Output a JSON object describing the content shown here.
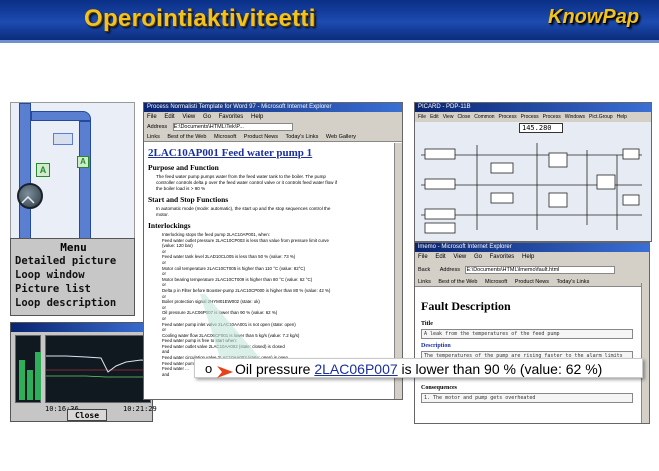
{
  "header": {
    "title": "Operointiaktiviteetti",
    "logo": "KnowPap"
  },
  "process": {
    "valve_label": "A",
    "valve_label_2": "A"
  },
  "menu": {
    "title": "Menu",
    "items": [
      "Detailed picture",
      "Loop window",
      "Picture list",
      "Loop description"
    ]
  },
  "trend": {
    "time_start": "10:16:36",
    "time_end": "10:21:29",
    "close_label": "Close"
  },
  "doc_window": {
    "titlebar": "Process Normalisti Template for Word 97 - Microsoft Internet Explorer",
    "menu": [
      "File",
      "Edit",
      "View",
      "Go",
      "Favorites",
      "Help"
    ],
    "address_label": "Address",
    "address_value": "E:\\Documents\\HTML\\Tek\\P...",
    "links": [
      "Links",
      "Best of the Web",
      "Microsoft",
      "Product News",
      "Today's Links",
      "Web Gallery"
    ],
    "heading": "2LAC10AP001 Feed water pump 1",
    "sections": [
      {
        "title": "Purpose and Function",
        "lines": [
          "The feed water pump pumps water from the feed water tank to the boiler. The pump",
          "controller controls delta p over the feed water control valve or it controls feed water flow if",
          "the boiler load is > 90 %"
        ]
      },
      {
        "title": "Start and Stop Functions",
        "lines": [
          "In automatic mode (mode: automatic), the start up and the stop sequences control the",
          "motor."
        ]
      },
      {
        "title": "Interlockings",
        "lines": [
          "Interlocking stops the feed pump 2LAC10AP001, when:",
          "Feed water outlet pressure 2LAC10CP003 is less than value from pressure limit curve",
          "(value: 120 bar)",
          "or",
          "Feed water tank level 2LAD10CL005 is less than 50 % (value: 73 %)",
          "or",
          "Motor coil temperature 2LAC10CT005 is higher than 110 °C (value: 82°C)",
          "or",
          "Motor bearing temperature 2LAC10CT009 is higher than 80 °C (value: 62 °C)",
          "or",
          "Delta p in Filter before Booster-pump 2LAC10CP000 is higher than 80 % (value: 42 %)",
          "or",
          "Boiler protection signal 2HYM01EW002 (state: ok)",
          "or",
          "Oil pressure 2LAC06P007 is lower than 90 % (value: 62 %)",
          "or",
          "Feed water pump inlet valve 2LAC10AA001 is not open (state: open)",
          "or",
          "Cooling water flow 2LAC06CF001 is lower than 5 kg/s (value: 7.2 kg/s)",
          "Feed water pump is free to start when:",
          "Feed water outlet valve 2LAC10AA002 (state: closed) is closed",
          "and",
          "Feed water circulation valve 2LAC10AA003 (state: open) is open",
          "Feed water pump is free to stop when:",
          "Feed water ...",
          "and"
        ]
      }
    ]
  },
  "schematic_window": {
    "titlebar": "PICARD - PDP-11B",
    "menu": [
      "File",
      "Edit",
      "View",
      "Close",
      "Common",
      "Process",
      "Process",
      "Process",
      "Windows",
      "Pict.Group",
      "Help"
    ],
    "value": "145.280"
  },
  "fault_window": {
    "titlebar": "lmemo - Microsoft Internet Explorer",
    "menu": [
      "File",
      "Edit",
      "View",
      "Go",
      "Favorites",
      "Help"
    ],
    "back_label": "Back",
    "address_label": "Address",
    "address_value": "E:\\Documents\\HTML\\lmemo\\fault.html",
    "links": [
      "Links",
      "Best of the Web",
      "Microsoft",
      "Product News",
      "Today's Links"
    ],
    "heading": "Fault Description",
    "title_label": "Title",
    "title_value": "A leak from the temperatures of the feed pump",
    "description_label": "Description",
    "description_value": "The temperatures of the pump are rising faster to the alarm limits and later in interlocking limits",
    "consequences_label": "Consequences",
    "consequences_value": "1. The motor and pump gets overheated"
  },
  "callout": {
    "bullet": "o",
    "prefix": "Oil pressure ",
    "tag": "2LAC06P007",
    "suffix": " is lower than 90 % (value: 62 %)"
  }
}
